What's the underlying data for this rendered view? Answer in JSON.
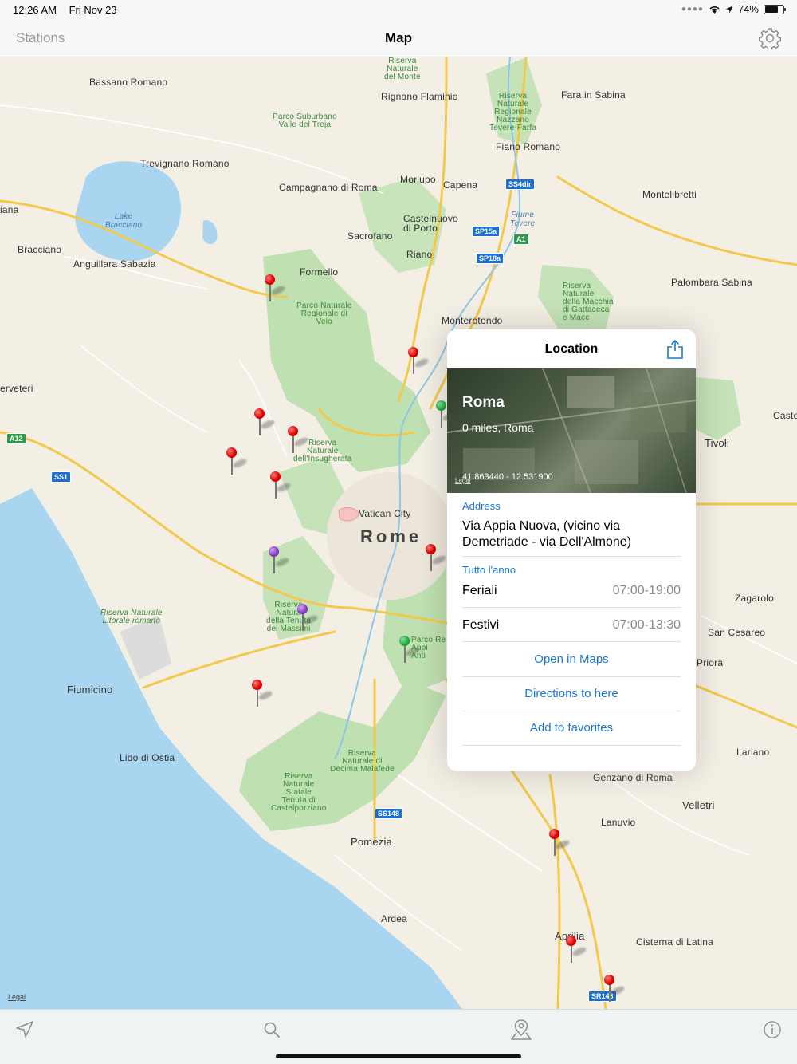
{
  "status_bar": {
    "time": "12:26 AM",
    "date": "Fri Nov 23",
    "battery": "74%"
  },
  "nav": {
    "left_label": "Stations",
    "title": "Map",
    "settings_icon": "gear-icon"
  },
  "map": {
    "legal": "Legal",
    "legal_inset": "Legal",
    "labels": {
      "bassano_romano": "Bassano Romano",
      "riserva_monte": "Riserva\nNaturale\ndel Monte",
      "rignano": "Rignano Flaminio",
      "fara_sabina": "Fara in Sabina",
      "riserva_nazzano": "Riserva\nNaturale\nRegionale\nNazzano\nTevere-Farfa",
      "parco_treja": "Parco Suburbano\nValle del Treja",
      "fiano": "Fiano Romano",
      "trevignano": "Trevignano Romano",
      "morlupo": "Morlupo",
      "capena": "Capena",
      "campagnano": "Campagnano di Roma",
      "montelibretti": "Montelibretti",
      "lake": "Lake\nBracciano",
      "castelnuovo": "Castelnuovo\ndi Porto",
      "fiume_tevere": "Fiume\nTevere",
      "sacrofano": "Sacrofano",
      "bracciano": "Bracciano",
      "anguillara": "Anguillara Sabazia",
      "riano": "Riano",
      "palombara": "Palombara Sabina",
      "formello": "Formello",
      "parco_veio": "Parco Naturale\nRegionale di\nVeio",
      "riserva_gattaceca": "Riserva\nNaturale\ndella Macchia\ndi Gattaceca\ne Macc",
      "monterotondo": "Monterotondo",
      "cerveteri": "erveteri",
      "riserva_insugherata": "Riserva\nNaturale\ndell'Insugherata",
      "tivoli": "Tivoli",
      "castel": "Caste",
      "vatican": "Vatican City",
      "rome": "Rome",
      "zagarolo": "Zagarolo",
      "riserva_litorale": "Riserva Naturale\nLitorale romano",
      "riserva_massimi": "Riserva\nNatura\ndella Tenuta\ndei Massimi",
      "san_cesareo": "San Cesareo",
      "parco_appia": "Parco Re\nAppi\nAnti",
      "priora": "Priora",
      "fiumicino": "Fiumicino",
      "lido_ostia": "Lido di Ostia",
      "lariano": "Lariano",
      "riserva_decima": "Riserva\nNaturale di\nDecima Malafede",
      "genzano": "Genzano di Roma",
      "riserva_castelporziano": "Riserva\nNaturale\nStatale\nTenuta di\nCastelporziano",
      "velletri": "Velletri",
      "lanuvio": "Lanuvio",
      "pomezia": "Pomezia",
      "ardea": "Ardea",
      "aprilia": "Aprilia",
      "cisterna": "Cisterna di Latina",
      "iana": "iana",
      "roma_riserva_small": "Riserva\nNaturale\nRegionale\ndi Ve",
      "riserva_east": "Riserva\nNaturale\nRegionale\nNazzano"
    },
    "road_badges": [
      "SS4dir",
      "SP15a",
      "A1",
      "SP18a",
      "A12",
      "SS1",
      "SS148",
      "SR148"
    ],
    "pin_colors": {
      "red": "#e00000",
      "green": "#20b040",
      "purple": "#8a3fc7"
    }
  },
  "popover": {
    "title": "Location",
    "share_icon": "share-icon",
    "place_name": "Roma",
    "distance": "0 miles, Roma",
    "coordinates": "41.863440 - 12.531900",
    "address_label": "Address",
    "address": "Via Appia Nuova, (vicino via Demetriade - via Dell'Almone)",
    "schedule_label": "Tutto l'anno",
    "rows": [
      {
        "label": "Feriali",
        "value": "07:00-19:00"
      },
      {
        "label": "Festivi",
        "value": "07:00-13:30"
      }
    ],
    "actions": {
      "open_maps": "Open in Maps",
      "directions": "Directions to here",
      "favorites": "Add to favorites"
    }
  },
  "tab_bar": {
    "icons": [
      "location-arrow-icon",
      "search-icon",
      "map-pin-icon",
      "info-icon"
    ]
  }
}
